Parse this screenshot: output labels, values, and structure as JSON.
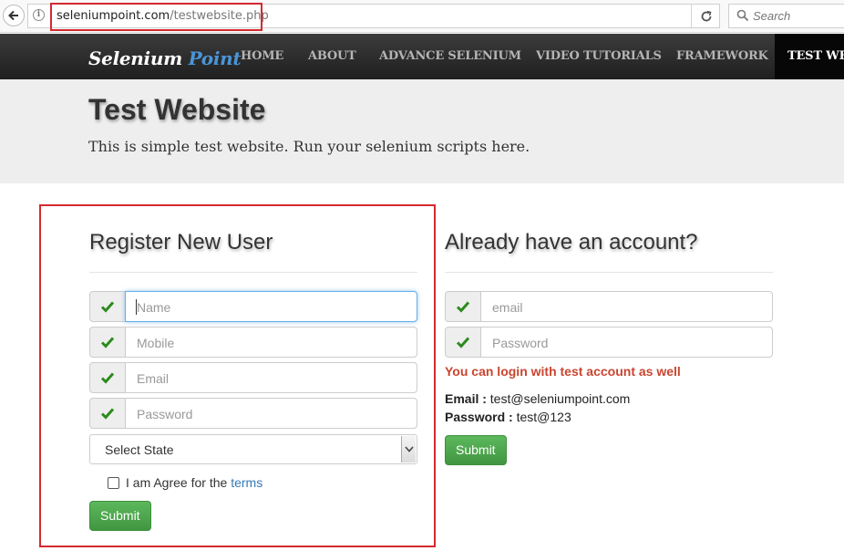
{
  "browser": {
    "url_domain": "seleniumpoint.com",
    "url_path": "/testwebsite.php",
    "search_placeholder": "Search"
  },
  "nav": {
    "brand_part1": "Selenium",
    "brand_part2": "Point",
    "items": [
      {
        "label": "HOME"
      },
      {
        "label": "ABOUT"
      },
      {
        "label": "ADVANCE SELENIUM"
      },
      {
        "label": "VIDEO TUTORIALS"
      },
      {
        "label": "FRAMEWORK"
      },
      {
        "label": "TEST WE"
      }
    ]
  },
  "jumbotron": {
    "title": "Test Website",
    "subtitle": "This is simple test website. Run your selenium scripts here."
  },
  "register": {
    "title": "Register New User",
    "name_placeholder": "Name",
    "mobile_placeholder": "Mobile",
    "email_placeholder": "Email",
    "password_placeholder": "Password",
    "state_selected": "Select State",
    "agree_text": "I am Agree for the",
    "terms_link": "terms",
    "submit_label": "Submit"
  },
  "login": {
    "title": "Already have an account?",
    "email_placeholder": "email",
    "password_placeholder": "Password",
    "note": "You can login with test account as well",
    "email_label": "Email :",
    "email_value": "test@seleniumpoint.com",
    "password_label": "Password :",
    "password_value": "test@123",
    "submit_label": "Submit"
  },
  "colors": {
    "highlight": "#d42a2f",
    "success": "#5cb85c",
    "check": "#2c8a1e",
    "note": "#c9452f",
    "link": "#337ab7"
  }
}
